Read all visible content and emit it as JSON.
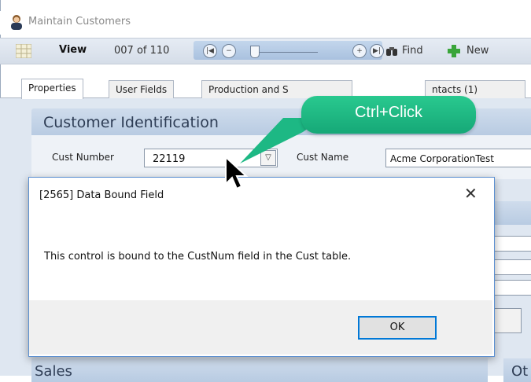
{
  "window": {
    "title": "Maintain Customers"
  },
  "toolbar": {
    "view_label": "View",
    "record_counter": "007 of 110",
    "find_label": "Find",
    "new_label": "New"
  },
  "tabs": [
    {
      "label": "Properties",
      "active": true
    },
    {
      "label": "User Fields"
    },
    {
      "label": "Production and S"
    },
    {
      "label": "ntacts (1)"
    }
  ],
  "section": {
    "title": "Customer Identification"
  },
  "fields": {
    "cust_number_label": "Cust Number",
    "cust_number_value": "22119",
    "cust_name_label": "Cust Name",
    "cust_name_value": "Acme CorporationTest"
  },
  "lower_sections": {
    "sales_title": "Sales",
    "other_title": "Ot"
  },
  "dialog": {
    "title": "[2565] Data Bound Field",
    "close_glyph": "✕",
    "message": "This control is bound to the CustNum field in the Cust table.",
    "ok_label": "OK"
  },
  "callout": {
    "text": "Ctrl+Click",
    "color": "#1db884"
  },
  "colors": {
    "accent": "#0078d7",
    "section_header": "#c4d4e8"
  }
}
